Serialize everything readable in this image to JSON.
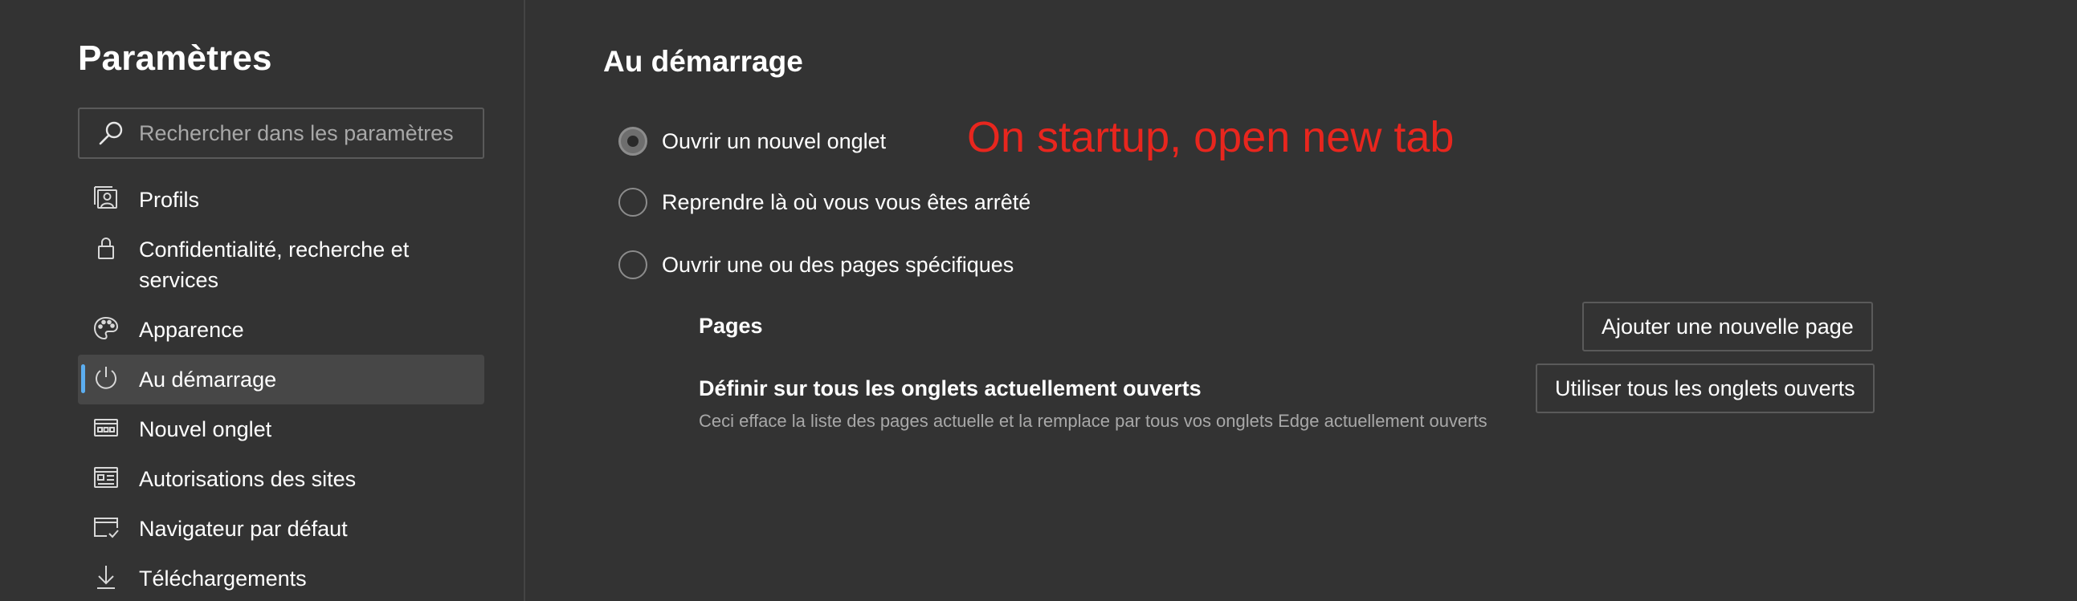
{
  "sidebar": {
    "title": "Paramètres",
    "search": {
      "placeholder": "Rechercher dans les paramètres",
      "value": ""
    },
    "items": [
      {
        "label": "Profils",
        "icon": "profile-icon",
        "active": false
      },
      {
        "label": "Confidentialité, recherche et services",
        "icon": "lock-icon",
        "active": false
      },
      {
        "label": "Apparence",
        "icon": "palette-icon",
        "active": false
      },
      {
        "label": "Au démarrage",
        "icon": "power-icon",
        "active": true
      },
      {
        "label": "Nouvel onglet",
        "icon": "new-tab-icon",
        "active": false
      },
      {
        "label": "Autorisations des sites",
        "icon": "site-permissions-icon",
        "active": false
      },
      {
        "label": "Navigateur par défaut",
        "icon": "default-browser-icon",
        "active": false
      },
      {
        "label": "Téléchargements",
        "icon": "download-icon",
        "active": false
      }
    ]
  },
  "main": {
    "title": "Au démarrage",
    "options": [
      {
        "label": "Ouvrir un nouvel onglet",
        "checked": true
      },
      {
        "label": "Reprendre là où vous vous êtes arrêté",
        "checked": false
      },
      {
        "label": "Ouvrir une ou des pages spécifiques",
        "checked": false
      }
    ],
    "annotation": "On startup, open new tab",
    "pages_label": "Pages",
    "add_page_button": "Ajouter une nouvelle page",
    "set_all_label": "Définir sur tous les onglets actuellement ouverts",
    "set_all_desc": "Ceci efface la liste des pages actuelle et la remplace par tous vos onglets Edge actuellement ouverts",
    "use_all_tabs_button": "Utiliser tous les onglets ouverts"
  },
  "colors": {
    "background": "#333333",
    "accent": "#5caef0",
    "annotation": "#e8261e",
    "active_item_bg": "#474747"
  }
}
